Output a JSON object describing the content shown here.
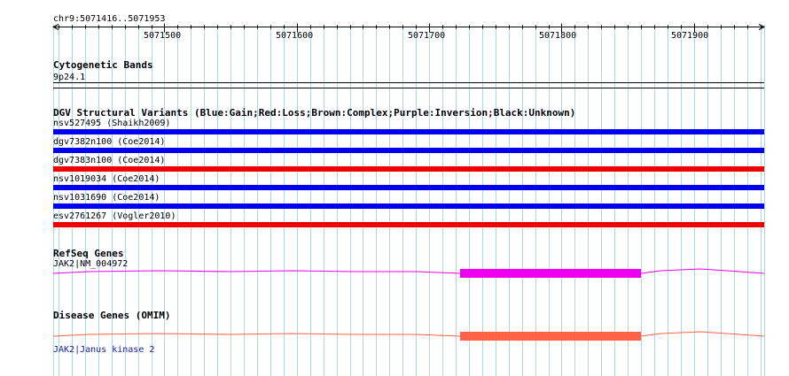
{
  "ruler": {
    "region": "chr9:5071416..5071953",
    "ticks": [
      "5071500",
      "5071600",
      "5071700",
      "5071800",
      "5071900"
    ],
    "ticks_pos": [
      5071500,
      5071600,
      5071700,
      5071800,
      5071900
    ],
    "start": 5071416,
    "end": 5071953
  },
  "tracks": {
    "cytoband": {
      "title": "Cytogenetic Bands",
      "band": "9p24.1"
    },
    "dgv": {
      "title": "DGV Structural Variants (Blue:Gain;Red:Loss;Brown:Complex;Purple:Inversion;Black:Unknown)",
      "variants": [
        {
          "label": "nsv527495 (Shaikh2009)",
          "color": "#0000ee"
        },
        {
          "label": "dgv7382n100 (Coe2014)",
          "color": "#0000ee"
        },
        {
          "label": "dgv7383n100 (Coe2014)",
          "color": "#ee0000"
        },
        {
          "label": "nsv1019034 (Coe2014)",
          "color": "#0000ee"
        },
        {
          "label": "nsv1031690 (Coe2014)",
          "color": "#0000ee"
        },
        {
          "label": "esv2761267 (Vogler2010)",
          "color": "#ee0000"
        }
      ]
    },
    "refseq": {
      "title": "RefSeq Genes",
      "gene": "JAK2|NM_004972",
      "color": "#ee00ee"
    },
    "omim": {
      "title": "Disease Genes (OMIM)",
      "gene": "JAK2|Janus kinase 2",
      "color": "#ff6347"
    }
  },
  "colors": {
    "grid": "#a9d8ee",
    "ruler": "#000000"
  }
}
